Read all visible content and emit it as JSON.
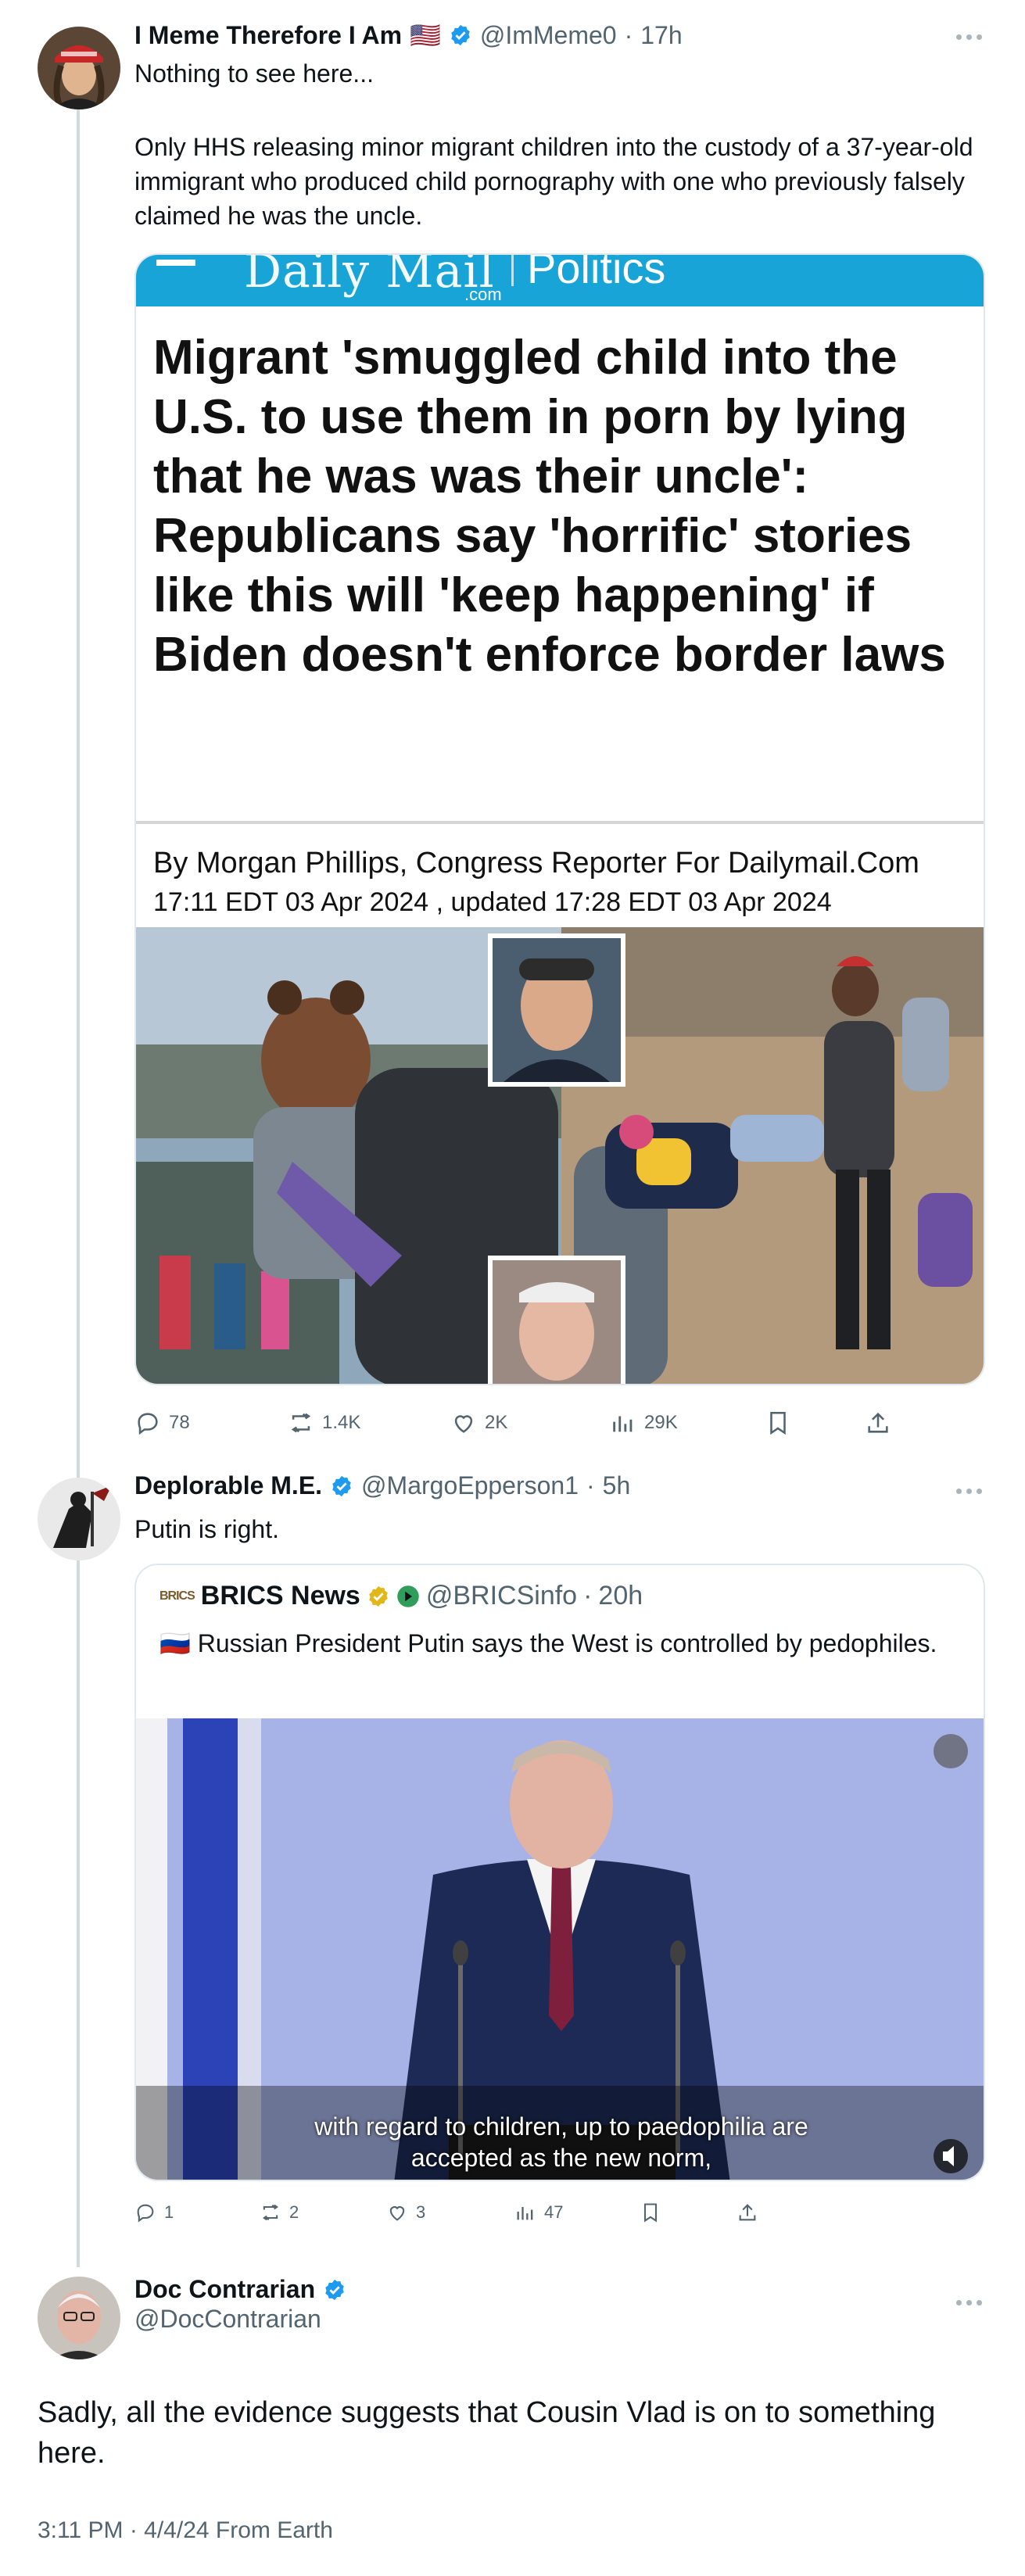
{
  "post1": {
    "name": "I Meme Therefore I Am",
    "flag": "🇺🇸",
    "handle": "@ImMeme0",
    "separator": "·",
    "time": "17h",
    "text_line1": "Nothing to see here...",
    "text_body": "Only HHS releasing minor migrant children into the custody of a 37-year-old immigrant who produced child pornography with one who previously falsely claimed he was the uncle.",
    "article": {
      "masthead": "Daily Mail",
      "masthead_com": ".com",
      "section": "Politics",
      "headline": "Migrant 'smuggled child into the U.S. to use them in porn by lying that he was was their uncle': Republicans say 'horrific' stories like this will 'keep happening' if Biden doesn't enforce border laws",
      "byline": "By Morgan Phillips, Congress Reporter For Dailymail.Com",
      "dateline": "17:11 EDT 03 Apr 2024 , updated 17:28 EDT 03 Apr 2024"
    },
    "actions": {
      "replies": "78",
      "reposts": "1.4K",
      "likes": "2K",
      "views": "29K"
    }
  },
  "post2": {
    "name": "Deplorable M.E.",
    "handle": "@MargoEpperson1",
    "separator": "·",
    "time": "5h",
    "text": "Putin is right.",
    "quote": {
      "logo_text": "BRICS",
      "name": "BRICS News",
      "handle": "@BRICSinfo",
      "separator": "·",
      "time": "20h",
      "flag": "🇷🇺",
      "text": "Russian President Putin says the West is controlled by pedophiles.",
      "caption_line1": "with regard to children, up to paedophilia are",
      "caption_line2": "accepted as the new norm,"
    },
    "actions": {
      "replies": "1",
      "reposts": "2",
      "likes": "3",
      "views": "47"
    }
  },
  "post3": {
    "name": "Doc Contrarian",
    "handle": "@DocContrarian",
    "text": "Sadly, all the evidence suggests that Cousin Vlad is on to something here.",
    "meta": "3:11 PM · 4/4/24 From Earth"
  },
  "colors": {
    "verified": "#1d9bf0",
    "muted": "#536471",
    "dm_blue": "#18a4d6",
    "border": "#e1e8ed"
  }
}
